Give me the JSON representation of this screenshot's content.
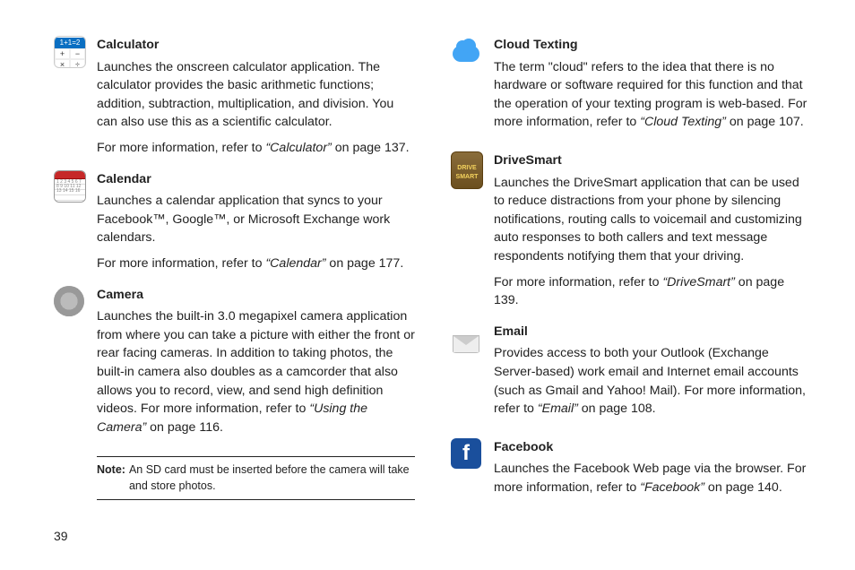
{
  "pageNumber": "39",
  "note": {
    "label": "Note:",
    "text": "An SD card must be inserted before the camera will take and store photos."
  },
  "left": [
    {
      "title": "Calculator",
      "desc": "Launches the onscreen calculator application. The calculator provides the basic arithmetic functions; addition, subtraction, multiplication, and division. You can also use this as a scientific calculator.",
      "more_prefix": "For more information, refer to ",
      "more_ref": "“Calculator”",
      "more_suffix": "  on page 137."
    },
    {
      "title": "Calendar",
      "desc": "Launches a calendar application that syncs to your Facebook™, Google™, or Microsoft Exchange work calendars.",
      "more_prefix": "For more information, refer to ",
      "more_ref": "“Calendar”",
      "more_suffix": "  on page 177."
    },
    {
      "title": "Camera",
      "desc_prefix": "Launches the built-in 3.0 megapixel camera application from where you can take a picture with either the front or rear facing cameras. In addition to taking photos, the built-in camera also doubles as a camcorder that also allows you to record, view, and send high definition videos. For more information, refer to ",
      "desc_ref": "“Using the Camera”",
      "desc_suffix": "  on page 116."
    }
  ],
  "right": [
    {
      "title": "Cloud Texting",
      "desc_prefix": "The term \"cloud\" refers to the idea that there is no hardware or software required for this function and that the operation of your texting program is web-based. For more information, refer to ",
      "desc_ref": "“Cloud Texting”",
      "desc_suffix": "  on page 107."
    },
    {
      "title": "DriveSmart",
      "desc": "Launches the DriveSmart application that can be used to reduce distractions from your phone by silencing notifications, routing calls to voicemail and customizing auto responses to both callers and text message respondents notifying them that your driving.",
      "more_prefix": "For more information, refer to ",
      "more_ref": "“DriveSmart”",
      "more_suffix": "  on page 139."
    },
    {
      "title": "Email",
      "desc_prefix": "Provides access to both your Outlook (Exchange Server-based) work email and Internet email accounts (such as Gmail and Yahoo! Mail). For more information, refer to ",
      "desc_ref": "“Email”",
      "desc_suffix": "  on page 108."
    },
    {
      "title": "Facebook",
      "desc_prefix": "Launches the Facebook Web page via the browser. For more information, refer to ",
      "desc_ref": "“Facebook”",
      "desc_suffix": "  on page 140."
    }
  ]
}
